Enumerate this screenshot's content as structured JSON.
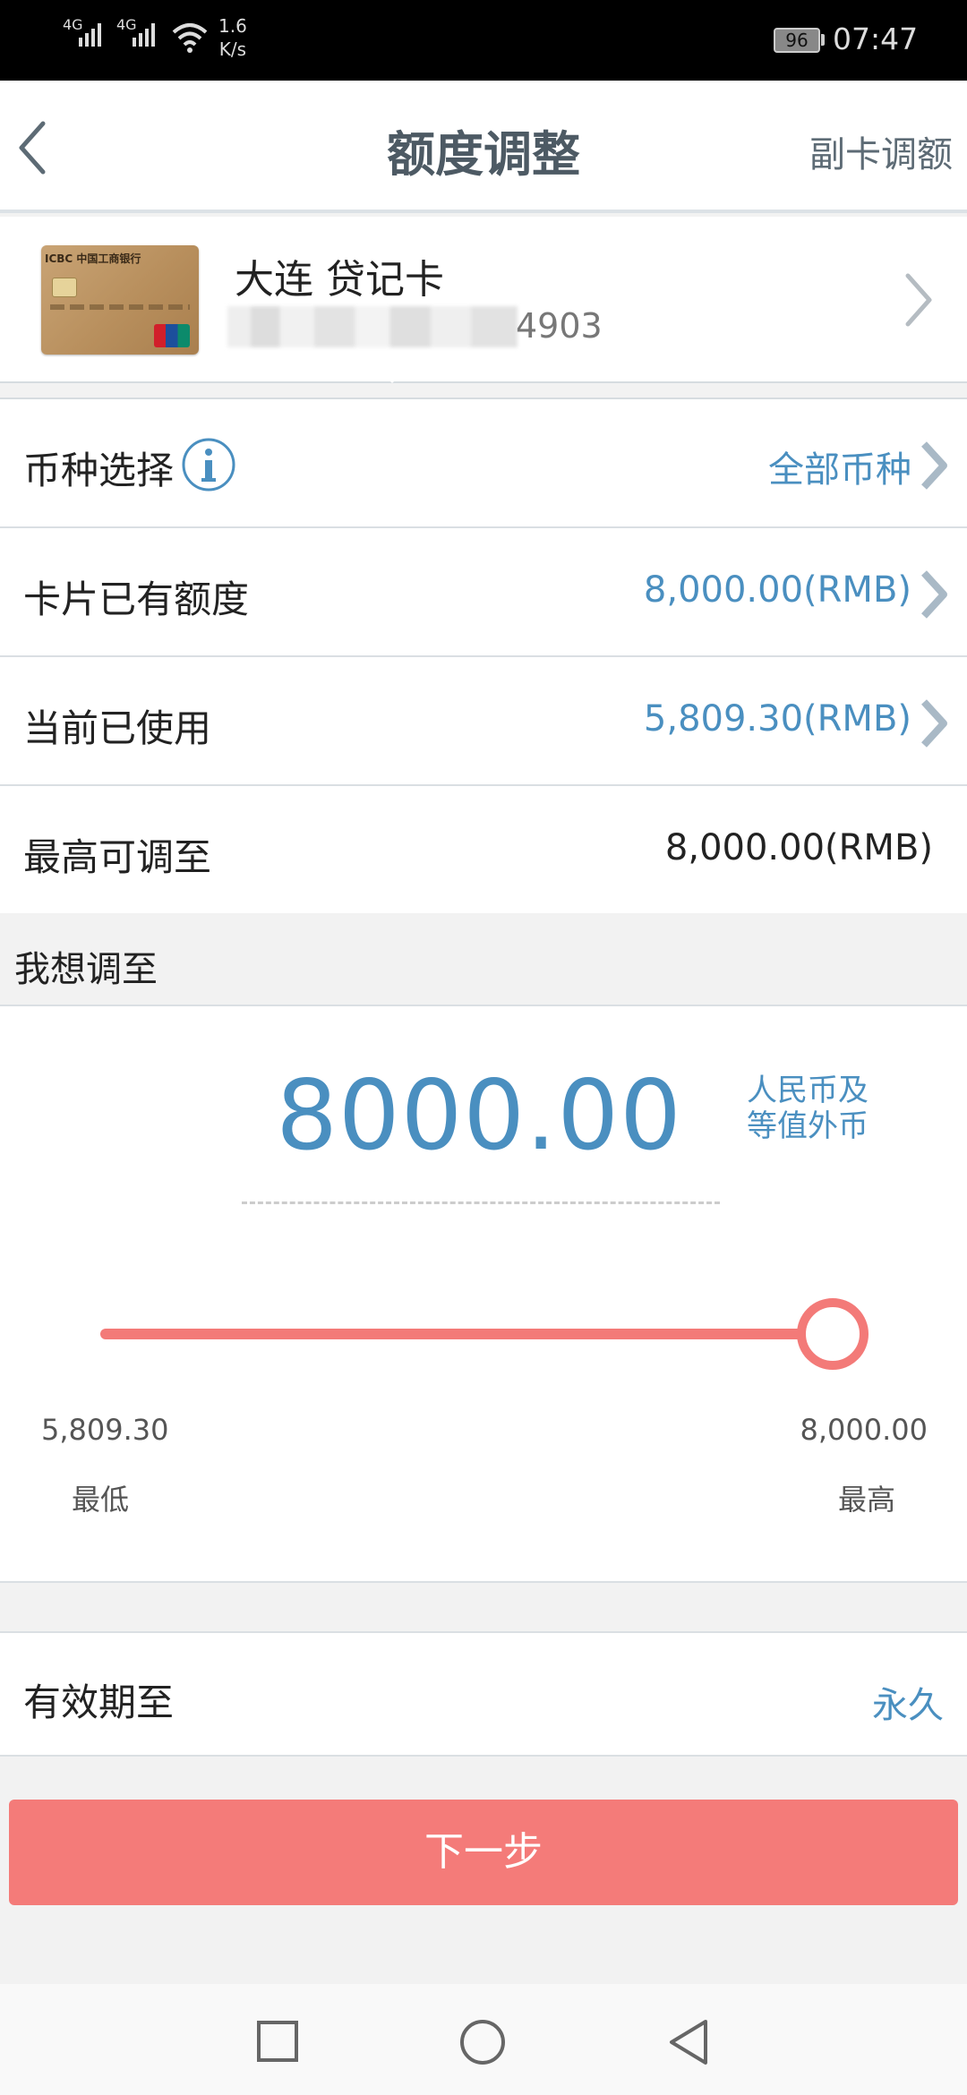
{
  "status_bar": {
    "network1": "4G",
    "network2": "4G",
    "speed_value": "1.6",
    "speed_unit": "K/s",
    "battery": "96",
    "time": "07:47"
  },
  "header": {
    "title": "额度调整",
    "right_action": "副卡调额"
  },
  "card": {
    "name": "大连 贷记卡",
    "number_suffix": "4903",
    "bank_label": "ICBC 中国工商银行"
  },
  "rows": {
    "currency": {
      "label": "币种选择",
      "value": "全部币种"
    },
    "existing_limit": {
      "label": "卡片已有额度",
      "value": "8,000.00(RMB)"
    },
    "used": {
      "label": "当前已使用",
      "value": "5,809.30(RMB)"
    },
    "max": {
      "label": "最高可调至",
      "value": "8,000.00(RMB)"
    }
  },
  "adjust": {
    "section_title": "我想调至",
    "amount": "8000.00",
    "currency_note_line1": "人民币及",
    "currency_note_line2": "等值外币",
    "min_value": "5,809.30",
    "min_label": "最低",
    "max_value": "8,000.00",
    "max_label": "最高",
    "slider_fraction": 1.0
  },
  "validity": {
    "label": "有效期至",
    "value": "永久"
  },
  "next_button": "下一步",
  "colors": {
    "accent_blue": "#4a8fc0",
    "button_red": "#f47b79",
    "title_gray": "#4d5a64"
  }
}
